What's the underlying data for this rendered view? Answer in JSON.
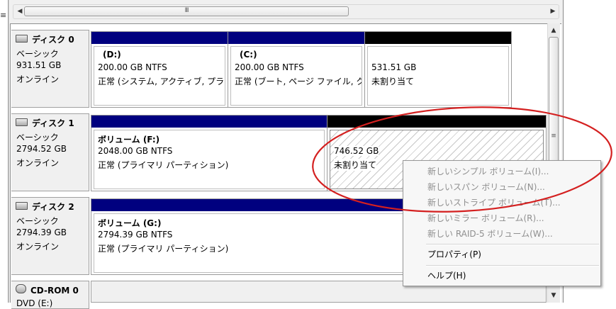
{
  "left_edge_glyph": "≡",
  "hscroll": {
    "grip": "III",
    "left_arrow": "◀",
    "right_arrow": "▶"
  },
  "vscroll": {
    "grip": "≡",
    "up_arrow": "▲",
    "down_arrow": "▼"
  },
  "disks": [
    {
      "name": "ディスク 0",
      "type": "ベーシック",
      "size": "931.51 GB",
      "status": "オンライン",
      "partitions": [
        {
          "label": "(D:)",
          "size_fs": "200.00 GB NTFS",
          "status": "正常 (システム, アクティブ, プラ",
          "bar": "#00007f"
        },
        {
          "label": "(C:)",
          "size_fs": "200.00 GB NTFS",
          "status": "正常 (ブート, ページ ファイル, ク",
          "bar": "#00007f"
        },
        {
          "label": "",
          "size_fs": "531.51 GB",
          "status": "未割り当て",
          "bar": "#000000"
        }
      ]
    },
    {
      "name": "ディスク 1",
      "type": "ベーシック",
      "size": "2794.52 GB",
      "status": "オンライン",
      "partitions": [
        {
          "label": "ボリューム (F:)",
          "size_fs": "2048.00 GB NTFS",
          "status": "正常 (プライマリ パーティション)",
          "bar": "#00007f"
        },
        {
          "label": "",
          "size_fs": "746.52 GB",
          "status": "未割り当て",
          "bar": "#000000",
          "selected": true
        }
      ]
    },
    {
      "name": "ディスク 2",
      "type": "ベーシック",
      "size": "2794.39 GB",
      "status": "オンライン",
      "partitions": [
        {
          "label": "ボリューム (G:)",
          "size_fs": "2794.39 GB NTFS",
          "status": "正常 (プライマリ パーティション)",
          "bar": "#00007f"
        }
      ]
    },
    {
      "name": "CD-ROM 0",
      "type": "DVD (E:)"
    }
  ],
  "context_menu": {
    "items": [
      {
        "label": "新しいシンプル ボリューム(I)...",
        "enabled": false
      },
      {
        "label": "新しいスパン ボリューム(N)...",
        "enabled": false
      },
      {
        "label": "新しいストライプ ボリューム(T)...",
        "enabled": false
      },
      {
        "label": "新しいミラー ボリューム(R)...",
        "enabled": false
      },
      {
        "label": "新しい RAID-5 ボリューム(W)...",
        "enabled": false
      },
      {
        "label": "プロパティ(P)",
        "enabled": true
      },
      {
        "label": "ヘルプ(H)",
        "enabled": true
      }
    ]
  },
  "colors": {
    "primary_bar": "#00007f",
    "unallocated_bar": "#000000",
    "annotation": "#d42020"
  }
}
